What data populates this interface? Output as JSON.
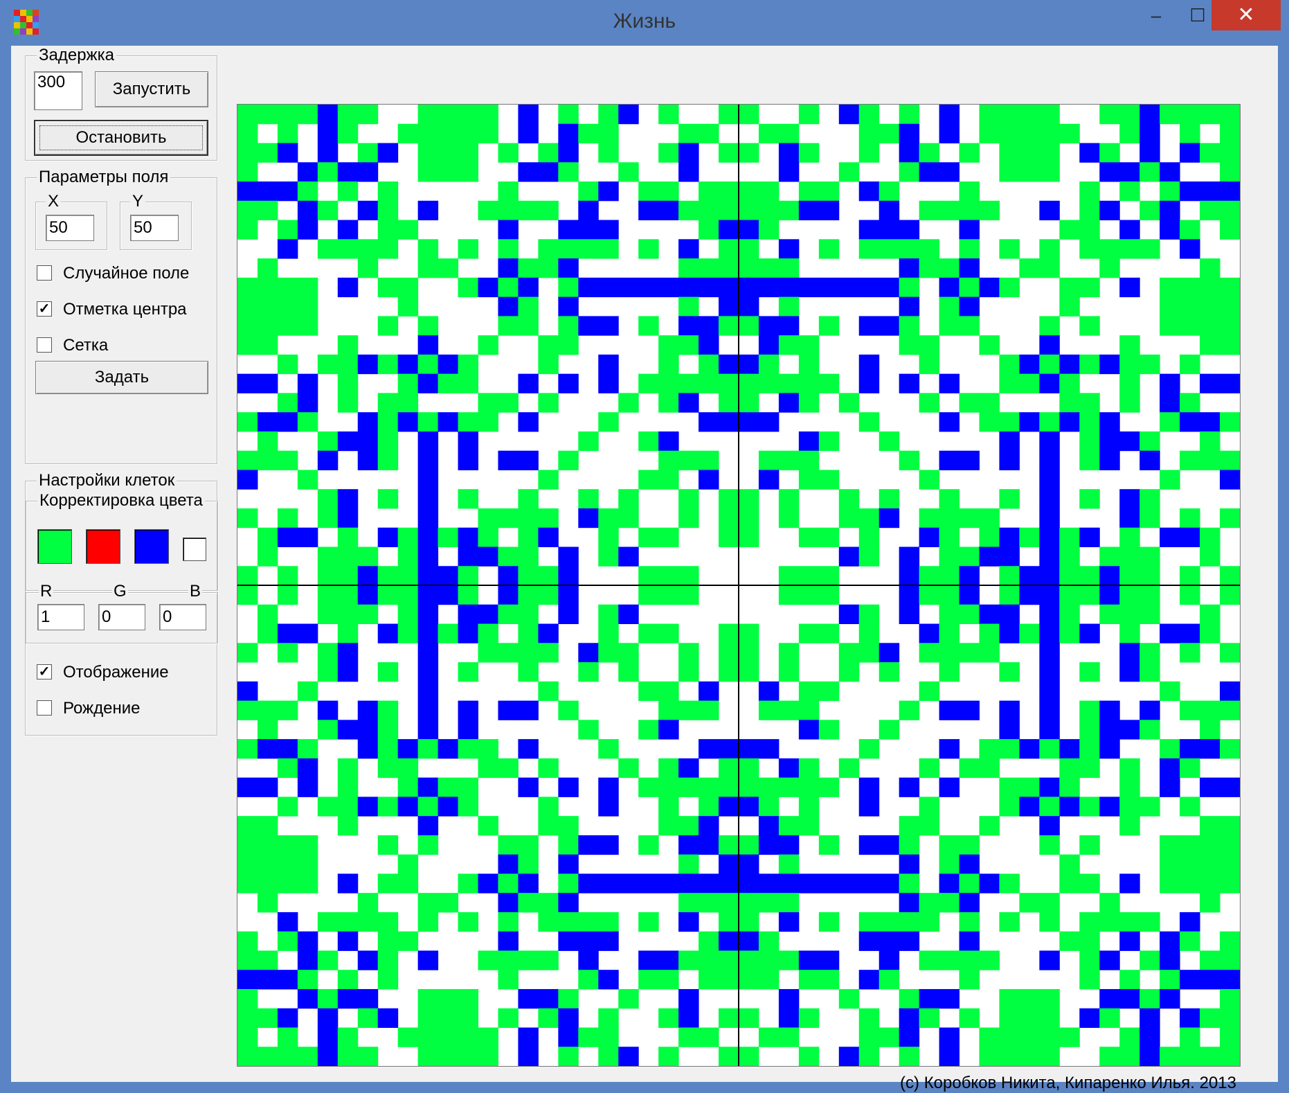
{
  "window": {
    "title": "Жизнь",
    "controls": {
      "minimize": "‒",
      "maximize": "☐",
      "close": "✕"
    }
  },
  "delay": {
    "legend": "Задержка",
    "value": "300",
    "start_label": "Запустить",
    "stop_label": "Остановить"
  },
  "field_params": {
    "legend": "Параметры поля",
    "x_legend": "X",
    "x_value": "50",
    "y_legend": "Y",
    "y_value": "50",
    "random_label": "Случайное поле",
    "random_checked": false,
    "center_label": "Отметка центра",
    "center_checked": true,
    "grid_label": "Сетка",
    "grid_checked": false,
    "set_label": "Задать"
  },
  "cell_settings": {
    "legend": "Настройки клеток",
    "color_legend": "Корректировка цвета",
    "swatches": [
      "#00ff40",
      "#ff0000",
      "#0000ff",
      "#ffffff"
    ],
    "r_label": "R",
    "g_label": "G",
    "b_label": "B",
    "r_value": "1",
    "g_value": "0",
    "b_value": "0",
    "display_label": "Отображение",
    "display_checked": true,
    "birth_label": "Рождение",
    "birth_checked": false
  },
  "field": {
    "size": 50,
    "colors": {
      "alive": "#00ff40",
      "born": "#0000ff",
      "empty": "#ffffff",
      "center_line": "#000000"
    },
    "center_marked": true
  },
  "copyright": "(с) Коробков Никита, Кипаренко Илья. 2013"
}
